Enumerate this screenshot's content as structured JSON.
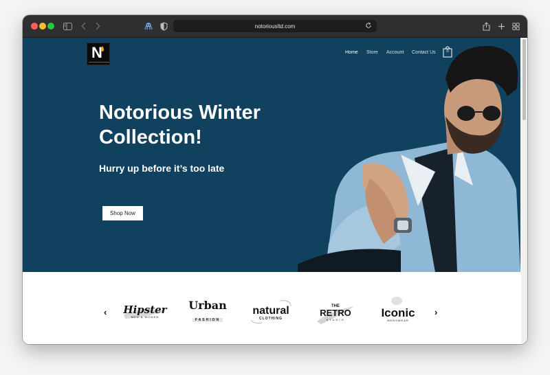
{
  "browser": {
    "url": "notoriousltd.com",
    "traffic_lights": [
      "close",
      "minimize",
      "zoom"
    ],
    "toolbar_icons": [
      "sidebar-icon",
      "back-icon",
      "forward-icon",
      "extension-icon",
      "shield-icon",
      "reload-icon",
      "share-icon",
      "new-tab-icon",
      "tab-overview-icon"
    ]
  },
  "site": {
    "logo_letter": "N",
    "nav": {
      "home": "Home",
      "store": "Store",
      "account": "Account",
      "contact": "Contact Us"
    },
    "cart_count": "0"
  },
  "hero": {
    "title_line1": "Notorious Winter",
    "title_line2": "Collection!",
    "subtitle": "Hurry up before it’s too late",
    "cta": "Shop Now",
    "background_color": "#10415f"
  },
  "brands": {
    "prev": "‹",
    "next": "›",
    "items": [
      {
        "name": "Hipster",
        "tagline": "MEN & WOMEN"
      },
      {
        "name": "Urban",
        "tagline": "FASHION"
      },
      {
        "name": "natural",
        "tagline": "CLOTHING"
      },
      {
        "name_top": "THE",
        "name": "RETRO",
        "tagline": "STUDIO"
      },
      {
        "name": "Iconic",
        "tagline": "MENSWEAR"
      }
    ]
  }
}
